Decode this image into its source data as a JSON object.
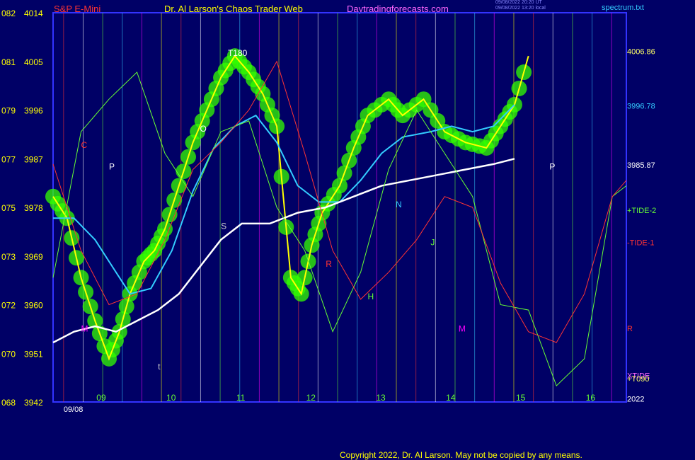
{
  "header": {
    "instrument": "S&P E-Mini",
    "site": "Dr. Al Larson's Chaos Trader Web",
    "url": "Daytradingforecasts.com",
    "stamp1": "09/08/2022 20:20 UT",
    "stamp2": "09/08/2022 13:20 local",
    "file": "spectrum.txt"
  },
  "footer": {
    "copyright": "Copyright 2022, Dr. Al Larson. May not be copied by any means."
  },
  "colors": {
    "background": "#000066",
    "frame": "#3333ff",
    "price": "#ffff00",
    "ma_fast": "#33ccff",
    "ma_slow": "#ffffff",
    "bubbles": "#33ff00",
    "tide2": "#66ff33",
    "tide1": "#ff3333",
    "xtide": "#ff66ff",
    "moon": "#ff00ff"
  },
  "chart_data": {
    "type": "line",
    "title": "S&P E-Mini",
    "ylim": [
      3942,
      4014
    ],
    "y_ticks": [
      {
        "left": "082",
        "right": "4014",
        "v": 4014
      },
      {
        "left": "081",
        "right": "4005",
        "v": 4005
      },
      {
        "left": "079",
        "right": "3996",
        "v": 3996
      },
      {
        "left": "077",
        "right": "3987",
        "v": 3987
      },
      {
        "left": "075",
        "right": "3978",
        "v": 3978
      },
      {
        "left": "073",
        "right": "3969",
        "v": 3969
      },
      {
        "left": "072",
        "right": "3960",
        "v": 3960
      },
      {
        "left": "070",
        "right": "3951",
        "v": 3951
      },
      {
        "left": "068",
        "right": "3942",
        "v": 3942
      }
    ],
    "xlim": [
      8.4,
      16.6
    ],
    "x_hour_labels": [
      {
        "x": 9.0,
        "t": "09"
      },
      {
        "x": 10.0,
        "t": "10"
      },
      {
        "x": 11.0,
        "t": "11"
      },
      {
        "x": 12.0,
        "t": "12"
      },
      {
        "x": 13.0,
        "t": "13"
      },
      {
        "x": 14.0,
        "t": "14"
      },
      {
        "x": 15.0,
        "t": "15"
      },
      {
        "x": 16.0,
        "t": "16"
      }
    ],
    "x_date_labels": [
      "09/08"
    ],
    "series": [
      {
        "name": "price",
        "points": [
          [
            8.4,
            3980
          ],
          [
            8.6,
            3976
          ],
          [
            8.8,
            3965
          ],
          [
            9.0,
            3957
          ],
          [
            9.2,
            3950
          ],
          [
            9.35,
            3955
          ],
          [
            9.5,
            3962
          ],
          [
            9.7,
            3968
          ],
          [
            9.85,
            3970
          ],
          [
            10.0,
            3974
          ],
          [
            10.2,
            3982
          ],
          [
            10.4,
            3990
          ],
          [
            10.6,
            3996
          ],
          [
            10.8,
            4002
          ],
          [
            11.0,
            4006
          ],
          [
            11.2,
            4003
          ],
          [
            11.4,
            3999
          ],
          [
            11.6,
            3993
          ],
          [
            11.8,
            3965
          ],
          [
            11.95,
            3962
          ],
          [
            12.1,
            3971
          ],
          [
            12.25,
            3977
          ],
          [
            12.5,
            3982
          ],
          [
            12.7,
            3989
          ],
          [
            12.9,
            3995
          ],
          [
            13.2,
            3998
          ],
          [
            13.4,
            3995
          ],
          [
            13.7,
            3998
          ],
          [
            14.0,
            3992
          ],
          [
            14.3,
            3990
          ],
          [
            14.6,
            3989
          ],
          [
            14.8,
            3993
          ],
          [
            15.0,
            3997
          ],
          [
            15.2,
            4006
          ]
        ]
      },
      {
        "name": "ma_fast",
        "points": [
          [
            8.4,
            3976
          ],
          [
            8.7,
            3976
          ],
          [
            9.0,
            3972
          ],
          [
            9.3,
            3966
          ],
          [
            9.5,
            3962
          ],
          [
            9.8,
            3963
          ],
          [
            10.1,
            3970
          ],
          [
            10.4,
            3981
          ],
          [
            10.7,
            3989
          ],
          [
            11.0,
            3993
          ],
          [
            11.3,
            3995
          ],
          [
            11.6,
            3990
          ],
          [
            11.9,
            3982
          ],
          [
            12.2,
            3979
          ],
          [
            12.5,
            3979
          ],
          [
            12.8,
            3983
          ],
          [
            13.1,
            3988
          ],
          [
            13.4,
            3991
          ],
          [
            13.8,
            3992
          ],
          [
            14.1,
            3993
          ],
          [
            14.4,
            3992
          ],
          [
            14.7,
            3993
          ],
          [
            15.0,
            3997
          ]
        ]
      },
      {
        "name": "ma_slow",
        "points": [
          [
            8.4,
            3953
          ],
          [
            8.7,
            3955
          ],
          [
            9.0,
            3956
          ],
          [
            9.3,
            3955
          ],
          [
            9.6,
            3957
          ],
          [
            9.9,
            3959
          ],
          [
            10.2,
            3962
          ],
          [
            10.5,
            3967
          ],
          [
            10.8,
            3972
          ],
          [
            11.1,
            3975
          ],
          [
            11.5,
            3975
          ],
          [
            11.9,
            3977
          ],
          [
            12.3,
            3978
          ],
          [
            12.7,
            3980
          ],
          [
            13.1,
            3982
          ],
          [
            13.5,
            3983
          ],
          [
            13.9,
            3984
          ],
          [
            14.3,
            3985
          ],
          [
            14.7,
            3986
          ],
          [
            15.0,
            3987
          ]
        ]
      },
      {
        "name": "+TIDE-2",
        "points": [
          [
            8.4,
            3965
          ],
          [
            8.8,
            3992
          ],
          [
            9.2,
            3998
          ],
          [
            9.6,
            4003
          ],
          [
            10.0,
            3988
          ],
          [
            10.4,
            3980
          ],
          [
            10.8,
            3992
          ],
          [
            11.2,
            3994
          ],
          [
            11.6,
            3978
          ],
          [
            12.0,
            3970
          ],
          [
            12.4,
            3955
          ],
          [
            12.8,
            3966
          ],
          [
            13.2,
            3985
          ],
          [
            13.6,
            3996
          ],
          [
            14.0,
            3988
          ],
          [
            14.4,
            3980
          ],
          [
            14.8,
            3960
          ],
          [
            15.2,
            3959
          ],
          [
            15.6,
            3945
          ],
          [
            16.0,
            3950
          ],
          [
            16.4,
            3980
          ],
          [
            16.6,
            3982
          ]
        ]
      },
      {
        "name": "-TIDE-1",
        "points": [
          [
            8.4,
            3986
          ],
          [
            8.8,
            3970
          ],
          [
            9.2,
            3960
          ],
          [
            9.6,
            3962
          ],
          [
            10.0,
            3972
          ],
          [
            10.4,
            3985
          ],
          [
            10.8,
            3990
          ],
          [
            11.2,
            3996
          ],
          [
            11.6,
            4005
          ],
          [
            12.0,
            3988
          ],
          [
            12.4,
            3970
          ],
          [
            12.8,
            3961
          ],
          [
            13.2,
            3966
          ],
          [
            13.6,
            3972
          ],
          [
            14.0,
            3980
          ],
          [
            14.4,
            3978
          ],
          [
            14.8,
            3964
          ],
          [
            15.2,
            3955
          ],
          [
            15.6,
            3953
          ],
          [
            16.0,
            3962
          ],
          [
            16.4,
            3980
          ],
          [
            16.6,
            3983
          ]
        ]
      }
    ],
    "labels": [
      {
        "x": 10.9,
        "v": 4006,
        "t": "T180",
        "c": "#ffffff"
      },
      {
        "x": 10.5,
        "v": 3992,
        "t": "O",
        "c": "#ffffff"
      },
      {
        "x": 9.2,
        "v": 3985,
        "t": "P",
        "c": "#ffffff"
      },
      {
        "x": 15.5,
        "v": 3985,
        "t": "P",
        "c": "#ffffff"
      },
      {
        "x": 8.8,
        "v": 3989,
        "t": "C",
        "c": "#ff3333"
      },
      {
        "x": 10.8,
        "v": 3974,
        "t": "S",
        "c": "#cccccc"
      },
      {
        "x": 13.3,
        "v": 3978,
        "t": "N",
        "c": "#33ccff"
      },
      {
        "x": 12.9,
        "v": 3961,
        "t": "H",
        "c": "#66ff33"
      },
      {
        "x": 13.8,
        "v": 3971,
        "t": "J",
        "c": "#66ff33"
      },
      {
        "x": 14.2,
        "v": 3955,
        "t": "M",
        "c": "#ff00ff"
      },
      {
        "x": 8.8,
        "v": 3955,
        "t": "M",
        "c": "#ff00ff"
      },
      {
        "x": 9.9,
        "v": 3948,
        "t": "t",
        "c": "#cccccc"
      },
      {
        "x": 12.3,
        "v": 3967,
        "t": "R",
        "c": "#ff3333"
      }
    ],
    "right_labels": [
      {
        "v": 4006.86,
        "t": "4006.86",
        "c": "#ffff66"
      },
      {
        "v": 3996.78,
        "t": "3996.78",
        "c": "#33ccff"
      },
      {
        "v": 3985.87,
        "t": "3985.87",
        "c": "#ffffff"
      },
      {
        "v": 3977.5,
        "t": "+TIDE-2",
        "c": "#66ff33"
      },
      {
        "v": 3971.5,
        "t": "-TIDE-1",
        "c": "#ff3333"
      },
      {
        "v": 3955.6,
        "t": "R",
        "c": "#ff3333"
      },
      {
        "v": 3946.9,
        "t": "XTIDE",
        "c": "#ff66ff"
      },
      {
        "v": 3946.3,
        "t": "+T090",
        "c": "#ffff66"
      },
      {
        "v": 3942.6,
        "t": "2022",
        "c": "#ffffff"
      }
    ]
  }
}
